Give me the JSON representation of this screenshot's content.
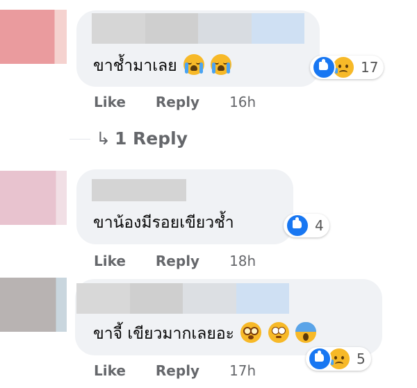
{
  "comments": [
    {
      "text": "ขาช้ำมาเลย",
      "emojis": [
        "loudly-crying-face-icon",
        "loudly-crying-face-icon"
      ],
      "reactions": [
        "like-icon",
        "sad-icon"
      ],
      "reaction_count": "17",
      "actions": {
        "like": "Like",
        "reply": "Reply",
        "time": "16h"
      },
      "replies_link": "1 Reply"
    },
    {
      "text": "ขาน้องมีรอยเขียวช้ำ",
      "emojis": [],
      "reactions": [
        "like-icon"
      ],
      "reaction_count": "4",
      "actions": {
        "like": "Like",
        "reply": "Reply",
        "time": "18h"
      }
    },
    {
      "text": "ขาจี้ เขียวมากเลยอะ",
      "emojis": [
        "dizzy-face-icon",
        "flushed-face-icon",
        "screaming-face-icon"
      ],
      "reactions": [
        "like-icon",
        "sad-icon"
      ],
      "reaction_count": "5",
      "actions": {
        "like": "Like",
        "reply": "Reply",
        "time": "17h"
      }
    }
  ],
  "colors": {
    "bubble": "#f0f2f5",
    "action_text": "#65676b",
    "like_blue": "#1877f2",
    "emoji_yellow": "#f7b928"
  }
}
